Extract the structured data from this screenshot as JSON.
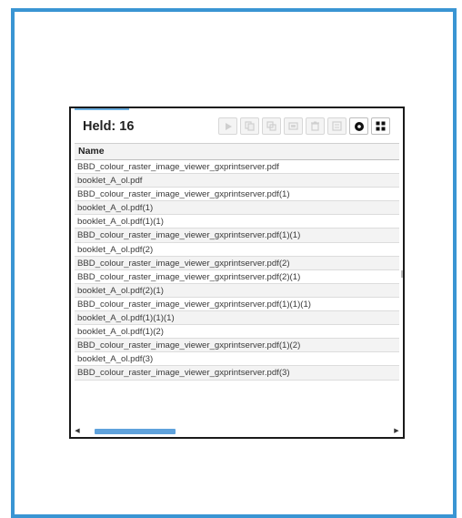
{
  "panel": {
    "title": "Held: 16",
    "toolbar": [
      {
        "icon": "play-icon",
        "enabled": false
      },
      {
        "icon": "copy-icon",
        "enabled": false
      },
      {
        "icon": "merge-icon",
        "enabled": false
      },
      {
        "icon": "preview-icon",
        "enabled": false
      },
      {
        "icon": "trash-icon",
        "enabled": false
      },
      {
        "icon": "details-icon",
        "enabled": false
      },
      {
        "icon": "settings-icon",
        "enabled": true
      },
      {
        "icon": "grid-view-icon",
        "enabled": true
      }
    ]
  },
  "table": {
    "header": "Name",
    "rows": [
      "BBD_colour_raster_image_viewer_gxprintserver.pdf",
      "booklet_A_ol.pdf",
      "BBD_colour_raster_image_viewer_gxprintserver.pdf(1)",
      "booklet_A_ol.pdf(1)",
      "booklet_A_ol.pdf(1)(1)",
      "BBD_colour_raster_image_viewer_gxprintserver.pdf(1)(1)",
      "booklet_A_ol.pdf(2)",
      "BBD_colour_raster_image_viewer_gxprintserver.pdf(2)",
      "BBD_colour_raster_image_viewer_gxprintserver.pdf(2)(1)",
      "booklet_A_ol.pdf(2)(1)",
      "BBD_colour_raster_image_viewer_gxprintserver.pdf(1)(1)(1)",
      "booklet_A_ol.pdf(1)(1)(1)",
      "booklet_A_ol.pdf(1)(2)",
      "BBD_colour_raster_image_viewer_gxprintserver.pdf(1)(2)",
      "booklet_A_ol.pdf(3)",
      "BBD_colour_raster_image_viewer_gxprintserver.pdf(3)"
    ]
  },
  "colors": {
    "frame": "#3a95d3",
    "scroll_thumb": "#5fa2dc"
  }
}
